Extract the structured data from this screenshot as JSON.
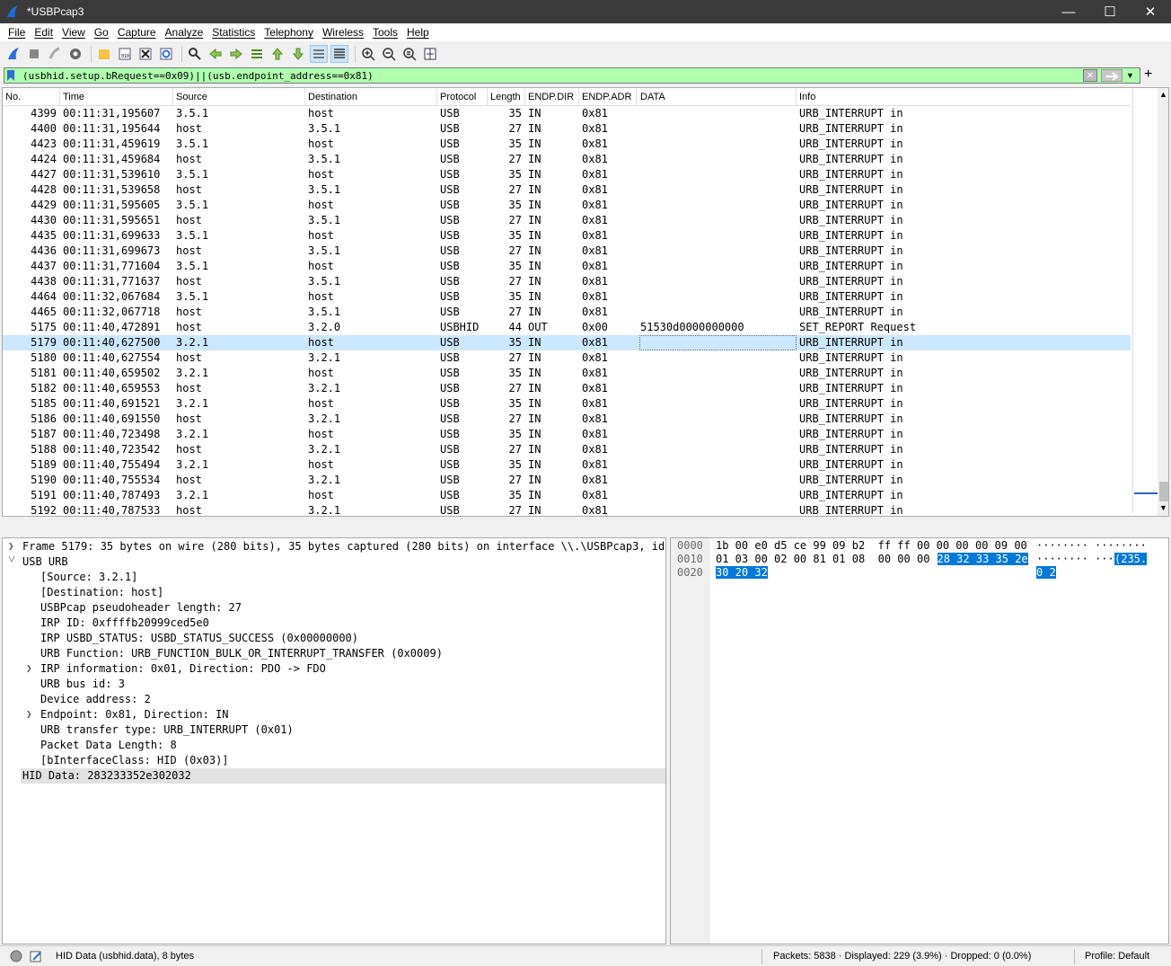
{
  "window": {
    "title": "*USBPcap3"
  },
  "menu": [
    "File",
    "Edit",
    "View",
    "Go",
    "Capture",
    "Analyze",
    "Statistics",
    "Telephony",
    "Wireless",
    "Tools",
    "Help"
  ],
  "toolbar": {
    "icons": [
      "start-capture-icon",
      "stop-capture-icon",
      "restart-capture-icon",
      "capture-options-icon",
      "open-file-icon",
      "save-file-icon",
      "close-file-icon",
      "reload-icon",
      "find-packet-icon",
      "go-back-icon",
      "go-forward-icon",
      "go-to-packet-icon",
      "first-packet-icon",
      "last-packet-icon",
      "autoscroll-icon",
      "colorize-icon",
      "zoom-in-icon",
      "zoom-out-icon",
      "normal-size-icon",
      "resize-columns-icon"
    ]
  },
  "filter": {
    "text": "(usbhid.setup.bRequest==0x09)||(usb.endpoint_address==0x81)",
    "bg_color": "#afffaf"
  },
  "packet_list": {
    "columns": [
      "No.",
      "Time",
      "Source",
      "Destination",
      "Protocol",
      "Length",
      "ENDP.DIR",
      "ENDP.ADR",
      "DATA",
      "Info"
    ],
    "selected_index": 15,
    "rows": [
      [
        "4399",
        "00:11:31,195607",
        "3.5.1",
        "host",
        "USB",
        "35",
        "IN",
        "0x81",
        "",
        "URB_INTERRUPT in"
      ],
      [
        "4400",
        "00:11:31,195644",
        "host",
        "3.5.1",
        "USB",
        "27",
        "IN",
        "0x81",
        "",
        "URB_INTERRUPT in"
      ],
      [
        "4423",
        "00:11:31,459619",
        "3.5.1",
        "host",
        "USB",
        "35",
        "IN",
        "0x81",
        "",
        "URB_INTERRUPT in"
      ],
      [
        "4424",
        "00:11:31,459684",
        "host",
        "3.5.1",
        "USB",
        "27",
        "IN",
        "0x81",
        "",
        "URB_INTERRUPT in"
      ],
      [
        "4427",
        "00:11:31,539610",
        "3.5.1",
        "host",
        "USB",
        "35",
        "IN",
        "0x81",
        "",
        "URB_INTERRUPT in"
      ],
      [
        "4428",
        "00:11:31,539658",
        "host",
        "3.5.1",
        "USB",
        "27",
        "IN",
        "0x81",
        "",
        "URB_INTERRUPT in"
      ],
      [
        "4429",
        "00:11:31,595605",
        "3.5.1",
        "host",
        "USB",
        "35",
        "IN",
        "0x81",
        "",
        "URB_INTERRUPT in"
      ],
      [
        "4430",
        "00:11:31,595651",
        "host",
        "3.5.1",
        "USB",
        "27",
        "IN",
        "0x81",
        "",
        "URB_INTERRUPT in"
      ],
      [
        "4435",
        "00:11:31,699633",
        "3.5.1",
        "host",
        "USB",
        "35",
        "IN",
        "0x81",
        "",
        "URB_INTERRUPT in"
      ],
      [
        "4436",
        "00:11:31,699673",
        "host",
        "3.5.1",
        "USB",
        "27",
        "IN",
        "0x81",
        "",
        "URB_INTERRUPT in"
      ],
      [
        "4437",
        "00:11:31,771604",
        "3.5.1",
        "host",
        "USB",
        "35",
        "IN",
        "0x81",
        "",
        "URB_INTERRUPT in"
      ],
      [
        "4438",
        "00:11:31,771637",
        "host",
        "3.5.1",
        "USB",
        "27",
        "IN",
        "0x81",
        "",
        "URB_INTERRUPT in"
      ],
      [
        "4464",
        "00:11:32,067684",
        "3.5.1",
        "host",
        "USB",
        "35",
        "IN",
        "0x81",
        "",
        "URB_INTERRUPT in"
      ],
      [
        "4465",
        "00:11:32,067718",
        "host",
        "3.5.1",
        "USB",
        "27",
        "IN",
        "0x81",
        "",
        "URB_INTERRUPT in"
      ],
      [
        "5175",
        "00:11:40,472891",
        "host",
        "3.2.0",
        "USBHID",
        "44",
        "OUT",
        "0x00",
        "51530d0000000000",
        "SET_REPORT Request"
      ],
      [
        "5179",
        "00:11:40,627500",
        "3.2.1",
        "host",
        "USB",
        "35",
        "IN",
        "0x81",
        "",
        "URB_INTERRUPT in"
      ],
      [
        "5180",
        "00:11:40,627554",
        "host",
        "3.2.1",
        "USB",
        "27",
        "IN",
        "0x81",
        "",
        "URB_INTERRUPT in"
      ],
      [
        "5181",
        "00:11:40,659502",
        "3.2.1",
        "host",
        "USB",
        "35",
        "IN",
        "0x81",
        "",
        "URB_INTERRUPT in"
      ],
      [
        "5182",
        "00:11:40,659553",
        "host",
        "3.2.1",
        "USB",
        "27",
        "IN",
        "0x81",
        "",
        "URB_INTERRUPT in"
      ],
      [
        "5185",
        "00:11:40,691521",
        "3.2.1",
        "host",
        "USB",
        "35",
        "IN",
        "0x81",
        "",
        "URB_INTERRUPT in"
      ],
      [
        "5186",
        "00:11:40,691550",
        "host",
        "3.2.1",
        "USB",
        "27",
        "IN",
        "0x81",
        "",
        "URB_INTERRUPT in"
      ],
      [
        "5187",
        "00:11:40,723498",
        "3.2.1",
        "host",
        "USB",
        "35",
        "IN",
        "0x81",
        "",
        "URB_INTERRUPT in"
      ],
      [
        "5188",
        "00:11:40,723542",
        "host",
        "3.2.1",
        "USB",
        "27",
        "IN",
        "0x81",
        "",
        "URB_INTERRUPT in"
      ],
      [
        "5189",
        "00:11:40,755494",
        "3.2.1",
        "host",
        "USB",
        "35",
        "IN",
        "0x81",
        "",
        "URB_INTERRUPT in"
      ],
      [
        "5190",
        "00:11:40,755534",
        "host",
        "3.2.1",
        "USB",
        "27",
        "IN",
        "0x81",
        "",
        "URB_INTERRUPT in"
      ],
      [
        "5191",
        "00:11:40,787493",
        "3.2.1",
        "host",
        "USB",
        "35",
        "IN",
        "0x81",
        "",
        "URB_INTERRUPT in"
      ],
      [
        "5192",
        "00:11:40,787533",
        "host",
        "3.2.1",
        "USB",
        "27",
        "IN",
        "0x81",
        "",
        "URB_INTERRUPT in"
      ]
    ]
  },
  "details": [
    {
      "text": "Frame 5179: 35 bytes on wire (280 bits), 35 bytes captured (280 bits) on interface \\\\.\\USBPcap3, id 0",
      "level": 0,
      "arrow": "collapsed"
    },
    {
      "text": "USB URB",
      "level": 0,
      "arrow": "expanded"
    },
    {
      "text": "[Source: 3.2.1]",
      "level": 1,
      "arrow": ""
    },
    {
      "text": "[Destination: host]",
      "level": 1,
      "arrow": ""
    },
    {
      "text": "USBPcap pseudoheader length: 27",
      "level": 1,
      "arrow": ""
    },
    {
      "text": "IRP ID: 0xffffb20999ced5e0",
      "level": 1,
      "arrow": ""
    },
    {
      "text": "IRP USBD_STATUS: USBD_STATUS_SUCCESS (0x00000000)",
      "level": 1,
      "arrow": ""
    },
    {
      "text": "URB Function: URB_FUNCTION_BULK_OR_INTERRUPT_TRANSFER (0x0009)",
      "level": 1,
      "arrow": ""
    },
    {
      "text": "IRP information: 0x01, Direction: PDO -> FDO",
      "level": 1,
      "arrow": "collapsed"
    },
    {
      "text": "URB bus id: 3",
      "level": 1,
      "arrow": ""
    },
    {
      "text": "Device address: 2",
      "level": 1,
      "arrow": ""
    },
    {
      "text": "Endpoint: 0x81, Direction: IN",
      "level": 1,
      "arrow": "collapsed"
    },
    {
      "text": "URB transfer type: URB_INTERRUPT (0x01)",
      "level": 1,
      "arrow": ""
    },
    {
      "text": "Packet Data Length: 8",
      "level": 1,
      "arrow": ""
    },
    {
      "text": "[bInterfaceClass: HID (0x03)]",
      "level": 1,
      "arrow": ""
    },
    {
      "text": "HID Data: 283233352e302032",
      "level": 0,
      "arrow": "",
      "highlight": true
    }
  ],
  "bytes": [
    {
      "offset": "0000",
      "hex_a": "1b 00 e0 d5 ce 99 09 b2  ff ff 00 00 00 00 09 00",
      "hex_hl": "",
      "ascii_a": "········ ········",
      "ascii_hl": ""
    },
    {
      "offset": "0010",
      "hex_a": "01 03 00 02 00 81 01 08  00 00 00 ",
      "hex_hl": "28 32 33 35 2e",
      "ascii_a": "········ ···",
      "ascii_hl": "(235."
    },
    {
      "offset": "0020",
      "hex_a": "",
      "hex_hl": "30 20 32",
      "ascii_a": "",
      "ascii_hl": "0 2"
    }
  ],
  "status": {
    "field": "HID Data (usbhid.data), 8 bytes",
    "counts": "Packets: 5838 · Displayed: 229 (3.9%) · Dropped: 0 (0.0%)",
    "profile": "Profile: Default"
  }
}
